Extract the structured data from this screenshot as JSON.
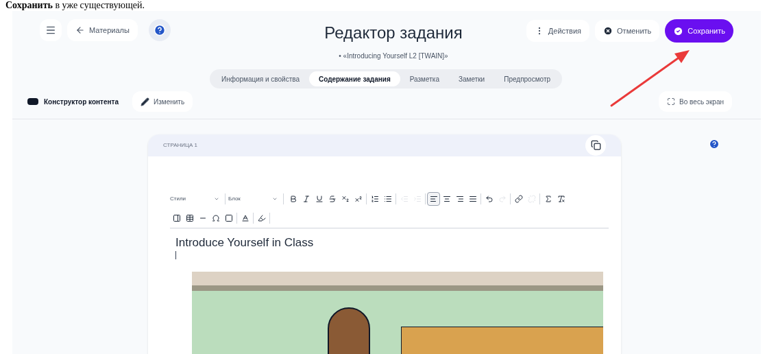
{
  "document_line": "**Сохранить** в уже существующей.",
  "header": {
    "back_label": "Материалы",
    "title": "Редактор задания",
    "subtitle": "• «Introducing Yourself L2 [TWAIN]»",
    "actions_label": "Действия",
    "cancel_label": "Отменить",
    "save_label": "Сохранить"
  },
  "tabs": [
    {
      "label": "Информация и свойства",
      "selected": false
    },
    {
      "label": "Содержание задания",
      "selected": true
    },
    {
      "label": "Разметка",
      "selected": false
    },
    {
      "label": "Заметки",
      "selected": false
    },
    {
      "label": "Предпросмотр",
      "selected": false
    }
  ],
  "subbar": {
    "constructor_label": "Конструктор контента",
    "edit_label": "Изменить",
    "fullscreen_label": "Во весь экран"
  },
  "page": {
    "label": "СТРАНИЦА 1",
    "styles_select": "Стили",
    "block_select": "Блок",
    "toolbar_buttons": [
      {
        "disabled": false,
        "selected": false
      },
      {
        "disabled": false,
        "selected": false
      },
      {
        "disabled": false,
        "selected": false
      },
      {
        "disabled": false,
        "selected": false
      },
      {
        "disabled": false,
        "selected": false
      },
      {
        "disabled": false,
        "selected": false
      },
      {
        "disabled": false,
        "selected": false
      },
      {
        "disabled": false,
        "selected": false
      },
      {
        "disabled": true,
        "selected": false
      },
      {
        "disabled": true,
        "selected": false
      },
      {
        "disabled": false,
        "selected": true
      },
      {
        "disabled": false,
        "selected": false
      },
      {
        "disabled": false,
        "selected": false
      },
      {
        "disabled": false,
        "selected": false
      },
      {
        "disabled": false,
        "selected": false
      },
      {
        "disabled": true,
        "selected": false
      },
      {
        "disabled": false,
        "selected": false
      },
      {
        "disabled": true,
        "selected": false
      },
      {
        "disabled": false,
        "selected": false
      },
      {
        "disabled": false,
        "selected": false
      },
      {
        "disabled": false,
        "selected": false
      },
      {
        "disabled": false,
        "selected": false
      },
      {
        "disabled": false,
        "selected": false
      },
      {
        "disabled": false,
        "selected": false
      },
      {
        "disabled": false,
        "selected": false
      },
      {
        "disabled": false,
        "selected": false
      },
      {
        "disabled": false,
        "selected": false
      }
    ],
    "heading": "Introduce Yourself in Class"
  }
}
